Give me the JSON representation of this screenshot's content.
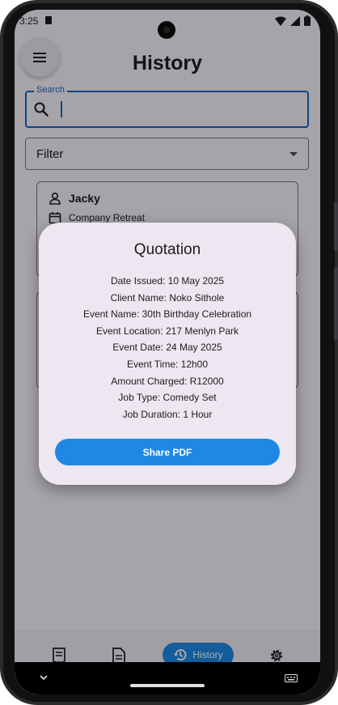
{
  "status": {
    "time": "3:25"
  },
  "page": {
    "title": "History"
  },
  "search": {
    "label": "Search",
    "value": "",
    "placeholder": ""
  },
  "filter": {
    "label": "Filter"
  },
  "cards": [
    {
      "name": "Jacky",
      "event": "Company Retreat"
    }
  ],
  "bottom_nav": {
    "active_label": "History",
    "items": [
      {
        "icon": "receipt-icon"
      },
      {
        "icon": "document-icon"
      },
      {
        "icon": "history-icon",
        "label": "History"
      },
      {
        "icon": "gear-icon"
      }
    ]
  },
  "dialog": {
    "title": "Quotation",
    "lines": [
      "Date Issued: 10 May 2025",
      "Client Name: Noko Sithole",
      "Event Name: 30th Birthday Celebration",
      "Event Location: 217 Menlyn Park",
      "Event Date: 24 May 2025",
      "Event Time: 12h00",
      "Amount Charged: R12000",
      "Job Type: Comedy Set",
      "Job Duration: 1 Hour"
    ],
    "share_label": "Share PDF"
  },
  "colors": {
    "accent": "#1e88e5",
    "focus_border": "#1565c0",
    "surface": "#f7f2fa",
    "dialog_surface": "#ece7f1"
  }
}
